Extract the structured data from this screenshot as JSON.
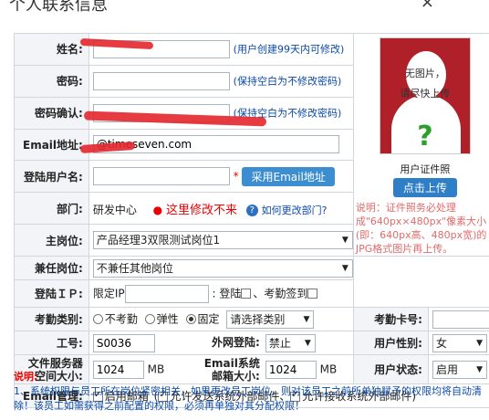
{
  "window": {
    "title": "个人联系信息",
    "close_glyph": "×"
  },
  "fields": {
    "name": {
      "label": "姓名:",
      "value": "",
      "hint": "(用户创建99天内可修改)"
    },
    "password": {
      "label": "密码:",
      "hint": "(保持空白为不修改密码)"
    },
    "confirm": {
      "label": "密码确认:",
      "hint": "(保持空白为不修改密码)"
    },
    "email": {
      "label": "Email地址:",
      "value": "@timeseven.com"
    },
    "login": {
      "label": "登陆用户名:",
      "value": "",
      "star": "*",
      "btn": "采用Email地址"
    },
    "dept": {
      "label": "部门:",
      "value": "研发中心",
      "annotation": "这里修改不来",
      "help": "如何更改部门?"
    },
    "main_post": {
      "label": "主岗位:",
      "value": "产品经理3双限测试岗位1"
    },
    "side_post": {
      "label": "兼任岗位:",
      "value": "不兼任其他岗位"
    },
    "ip": {
      "label": "登陆ＩＰ:",
      "prefix": "限定IP",
      "colon": ":",
      "login_lbl": "登陆",
      "sep": "、",
      "checkin_lbl": "考勤签到"
    },
    "attendance": {
      "label": "考勤类别:",
      "o1": "不考勤",
      "o2": "弹性",
      "o3": "固定",
      "select": "请选择类别",
      "card_label": "考勤卡号:"
    },
    "workno": {
      "label": "工号:",
      "value": "S0036",
      "ext_label": "外网登陆:",
      "ext_value": "禁止",
      "gender_label": "用户性别:",
      "gender_value": "女"
    },
    "storage": {
      "label1": "文件服务器",
      "label2": "空间大小:",
      "value": "1024",
      "unit": "MB",
      "email_label1": "Email系统",
      "email_label2": "邮箱大小:",
      "email_value": "1024",
      "email_unit": "MB",
      "status_label": "用户状态:",
      "status_value": "启用"
    },
    "email_mgmt": {
      "label": "Email管理:",
      "c1": "启用邮箱",
      "c2": "允许发送系统外部邮件、",
      "c3": "允许接收系统外部邮件)"
    }
  },
  "photo": {
    "line1": "无图片，",
    "line2": "请尽快上传",
    "mark": "?",
    "caption": "用户证件照",
    "upload": "点击上传",
    "note": "说明：证件照务必处理成\"640px×480px\"像素大小(即：640px高、480px宽)的JPG格式图片再上传。"
  },
  "note": {
    "heading": "说明:",
    "body": "1、系统权限与员工所在岗位紧密相关，如果更改员工岗位，则对该员工之前所单独赋予的权限均将自动清除！该员工如需获得之前配置的权限，必须再单独对其分配权限！"
  }
}
